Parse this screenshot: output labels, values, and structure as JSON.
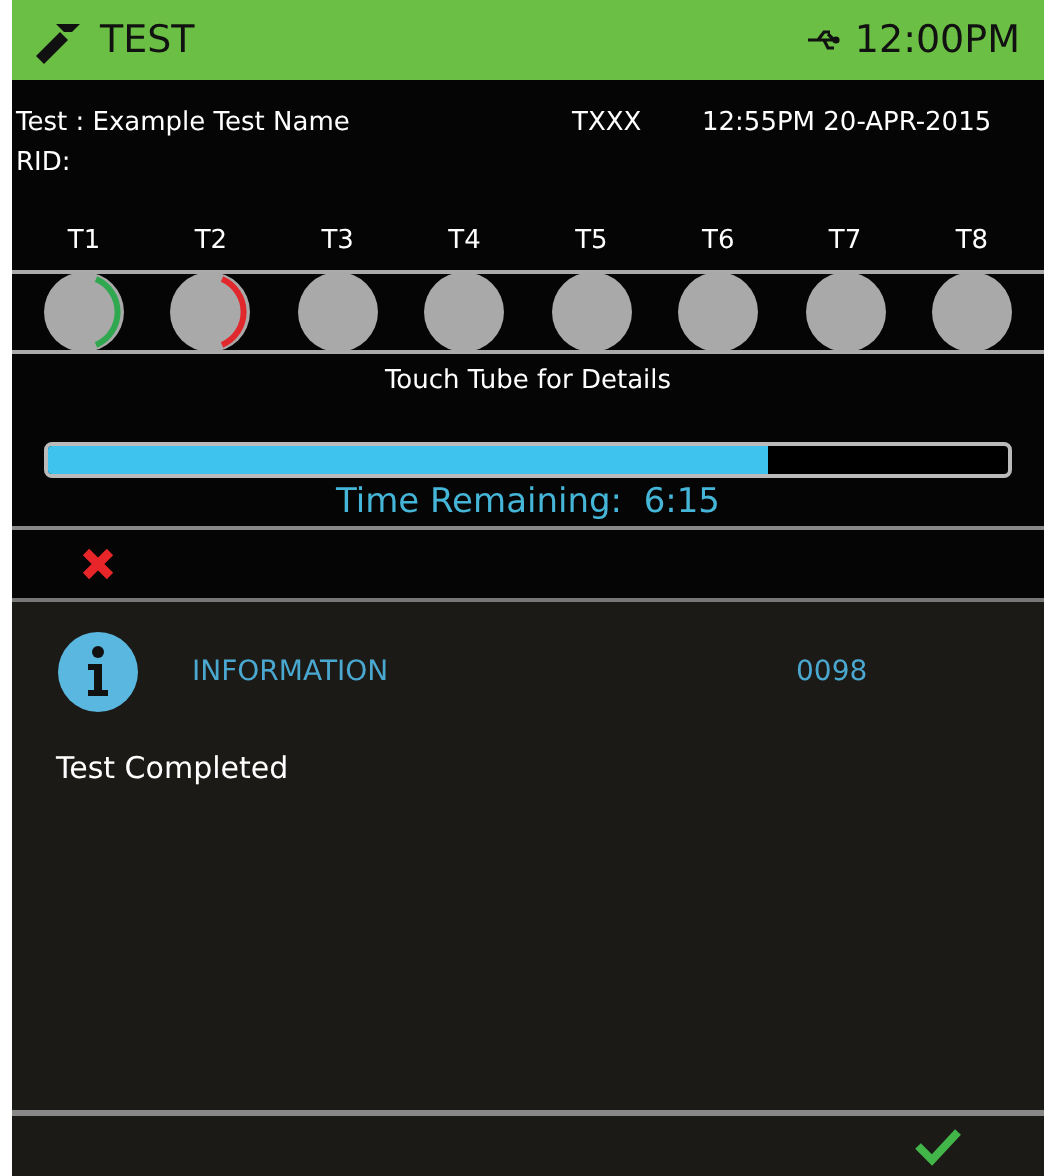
{
  "header": {
    "title": "TEST",
    "time": "12:00PM"
  },
  "info": {
    "test": "Test : Example Test Name",
    "code": "TXXX",
    "datetime": "12:55PM 20-APR-2015",
    "rid": "RID:"
  },
  "tubes": [
    {
      "label": "T1",
      "color": "#2fa84f"
    },
    {
      "label": "T2",
      "color": "#e0282d"
    },
    {
      "label": "T3"
    },
    {
      "label": "T4"
    },
    {
      "label": "T5"
    },
    {
      "label": "T6"
    },
    {
      "label": "T7"
    },
    {
      "label": "T8"
    }
  ],
  "hint": "Touch Tube for Details",
  "progress": {
    "level": 0.75,
    "reading": "Time Remaining:  6:15"
  },
  "dialog": {
    "title": "INFORMATION",
    "code": "0098",
    "message": "Test Completed"
  }
}
